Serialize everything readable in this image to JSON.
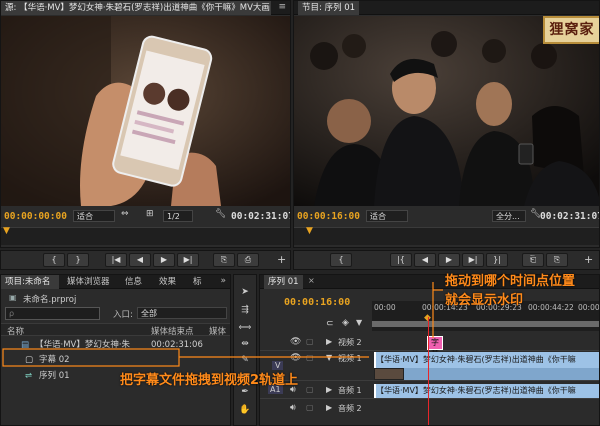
{
  "source_monitor": {
    "tab": "源: 【华语·MV】梦幻女神·朱碧石(罗志祥)出道神曲《你干嘛》MV大画",
    "timecode_left": "00:00:00:00",
    "fit": "适合",
    "ratio": "1/2",
    "timecode_right": "00:02:31:07",
    "transport": [
      "{",
      "}",
      "|◀",
      "◀",
      "▶",
      "▶|",
      "⎘",
      "⎙"
    ]
  },
  "program_monitor": {
    "tab": "节目: 序列 01",
    "timecode_left": "00:00:16:00",
    "fit": "适合",
    "zoom": "全分...",
    "timecode_right": "00:02:31:07",
    "watermark": "狸窝家",
    "transport": [
      "{",
      "|{",
      "◀",
      "▶",
      "▶|",
      "}|",
      "⎗",
      "⎘"
    ]
  },
  "project_panel": {
    "tabs": [
      "项目:未命名",
      "媒体浏览器",
      "信息",
      "效果",
      "标"
    ],
    "project_file": "未命名.prproj",
    "search_placeholder": "ρ",
    "entry_label": "入口:",
    "entry_value": "全部",
    "col_name": "名称",
    "col_media_end": "媒体结束点",
    "col_media_sub": "媒体",
    "items": [
      {
        "name": "【华语·MV】梦幻女神·朱",
        "end": "00:02:31:06"
      },
      {
        "name": "字幕 02",
        "end": ""
      },
      {
        "name": "序列 01",
        "end": ""
      }
    ]
  },
  "timeline": {
    "tab": "序列 01",
    "timecode": "00:00:16:00",
    "ruler_ticks": [
      "00:00",
      "00:00:14:23",
      "00:00:29:23",
      "00:00:44:22",
      "00:00:59:22"
    ],
    "tracks": [
      {
        "name": "视频 2"
      },
      {
        "name": "视频 1",
        "side": "V"
      },
      {
        "name": "音频 1",
        "side": "A1"
      },
      {
        "name": "音频 2"
      }
    ],
    "caption_clip": "字幕",
    "video_clip": "【华语·MV】梦幻女神·朱碧石(罗志祥)出道神曲《你干嘛",
    "audio_clip": "【华语·MV】梦幻女神·朱碧石(罗志祥)出道神曲《你干嘛"
  },
  "annotations": {
    "drag_time": "拖动到哪个时间点位置",
    "show_watermark": "就会显示水印",
    "drag_caption": "把字幕文件拖拽到视频2轨道上"
  },
  "colors": {
    "timecode": "#e8a320",
    "annotation": "#ff8a1a",
    "clip": "#9dc2e6",
    "caption_clip": "#f05fb0"
  }
}
